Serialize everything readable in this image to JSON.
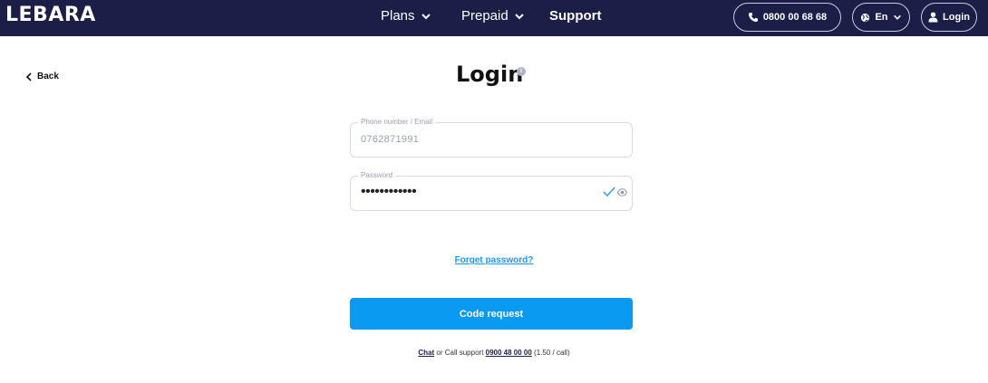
{
  "brand": {
    "logo": "LEBARA"
  },
  "nav": {
    "plans": "Plans",
    "prepaid": "Prepaid",
    "support": "Support"
  },
  "header_actions": {
    "phone": "0800 00 68 68",
    "language": "En",
    "login": "Login"
  },
  "back_label": "Back",
  "page_title": "Login",
  "form": {
    "phone_email": {
      "label": "Phone number / Email",
      "value": "0762871991"
    },
    "password": {
      "label": "Password",
      "value": "••••••••••••"
    },
    "forget_label": "Forget password?",
    "submit_label": "Code request"
  },
  "footer": {
    "chat": "Chat",
    "call_text": " or Call support ",
    "support_number": "0900 48 00 00",
    "rate": " (1.50 / call)"
  },
  "colors": {
    "topbar": "#1b1f47",
    "accent": "#0a9af2",
    "link": "#2096f3",
    "check": "#2aa3d8"
  },
  "icons": [
    "phone-icon",
    "globe-icon",
    "user-icon",
    "chevron-down-icon",
    "chevron-left-icon",
    "info-icon",
    "check-icon",
    "eye-icon"
  ]
}
